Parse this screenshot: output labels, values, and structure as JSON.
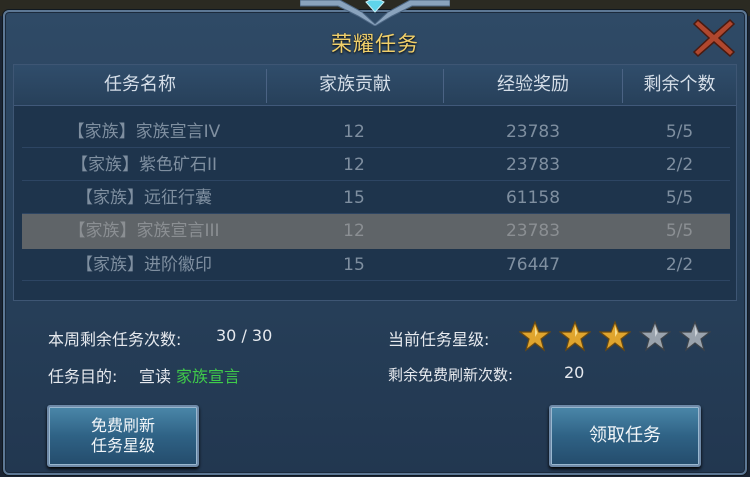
{
  "dialog": {
    "title": "荣耀任务"
  },
  "table": {
    "headers": [
      "任务名称",
      "家族贡献",
      "经验奖励",
      "剩余个数"
    ],
    "rows": [
      {
        "name": "【家族】家族宣言IV",
        "contribution": "12",
        "exp": "23783",
        "remaining": "5/5"
      },
      {
        "name": "【家族】紫色矿石II",
        "contribution": "12",
        "exp": "23783",
        "remaining": "2/2"
      },
      {
        "name": "【家族】远征行囊",
        "contribution": "15",
        "exp": "61158",
        "remaining": "5/5"
      },
      {
        "name": "【家族】家族宣言III",
        "contribution": "12",
        "exp": "23783",
        "remaining": "5/5"
      },
      {
        "name": "【家族】进阶徽印",
        "contribution": "15",
        "exp": "76447",
        "remaining": "2/2"
      }
    ]
  },
  "info": {
    "weekly_label": "本周剩余任务次数:",
    "weekly_value": "30 / 30",
    "goal_label": "任务目的:",
    "goal_prefix": "宣读",
    "goal_highlight": "家族宣言",
    "star_label": "当前任务星级:",
    "stars_filled": 3,
    "stars_total": 5,
    "refresh_label": "剩余免费刷新次数:",
    "refresh_value": "20"
  },
  "buttons": {
    "refresh_line1": "免费刷新",
    "refresh_line2": "任务星级",
    "accept": "领取任务"
  },
  "colors": {
    "title": "#f0cf6a",
    "highlight": "#3fcc4a",
    "star_gold": "#e0a52e",
    "star_grey": "#9aa3ad"
  }
}
